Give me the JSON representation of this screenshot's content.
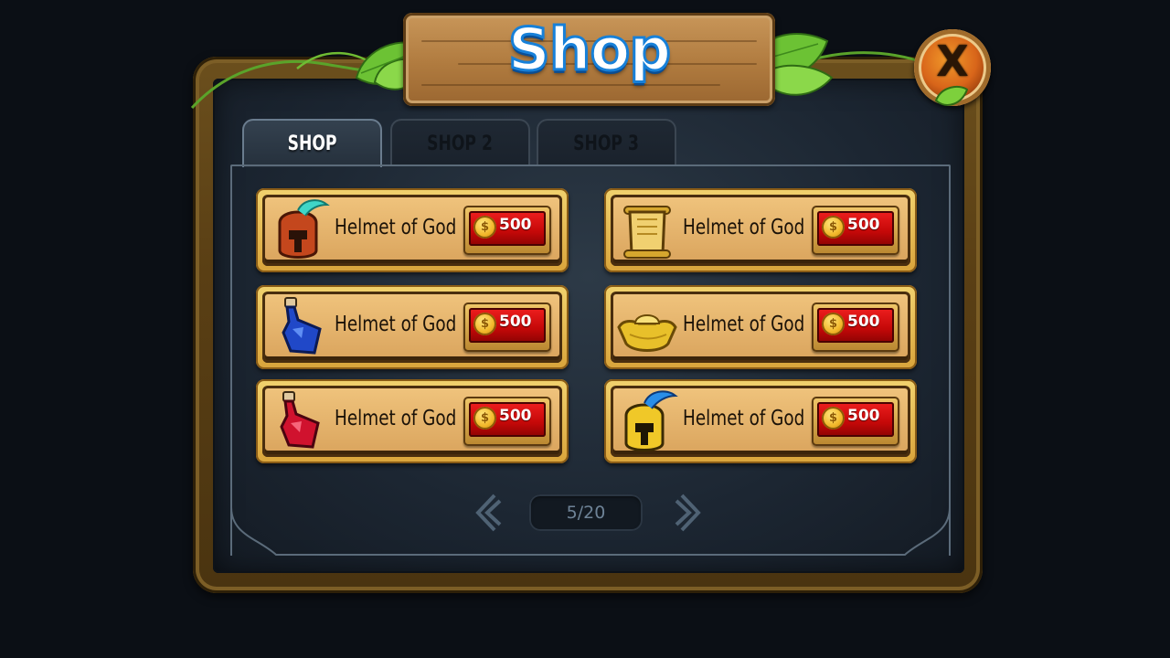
{
  "title": "Shop",
  "close_label": "X",
  "tabs": [
    {
      "label": "SHOP",
      "active": true
    },
    {
      "label": "SHOP 2",
      "active": false
    },
    {
      "label": "SHOP 3",
      "active": false
    }
  ],
  "items": [
    {
      "name": "Helmet of God",
      "price": "500",
      "icon": "red-helmet-icon"
    },
    {
      "name": "Helmet of God",
      "price": "500",
      "icon": "scroll-icon"
    },
    {
      "name": "Helmet of God",
      "price": "500",
      "icon": "blue-potion-icon"
    },
    {
      "name": "Helmet of God",
      "price": "500",
      "icon": "gold-ingot-icon"
    },
    {
      "name": "Helmet of God",
      "price": "500",
      "icon": "red-potion-icon"
    },
    {
      "name": "Helmet of God",
      "price": "500",
      "icon": "gold-helmet-icon"
    }
  ],
  "currency_symbol": "$",
  "pager": {
    "text": "5/20",
    "current": 5,
    "total": 20
  },
  "colors": {
    "background": "#0b0f15",
    "frame_wood": "#5a3f14",
    "title_stroke": "#1780d8",
    "price_red": "#c40808",
    "coin_gold": "#f2b72a",
    "tab_active_text": "#ffffff"
  }
}
